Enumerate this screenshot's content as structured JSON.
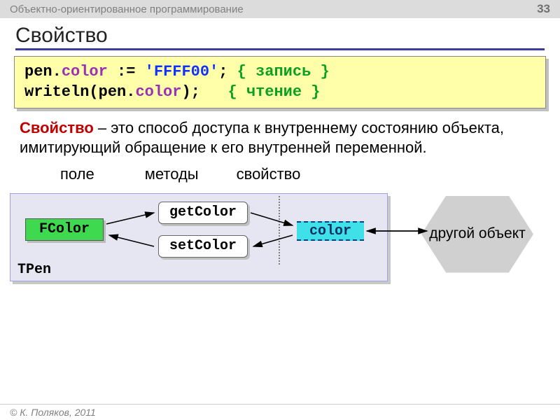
{
  "header": {
    "topic": "Объектно-ориентированное программирование",
    "page_number": "33"
  },
  "title": "Свойство",
  "code": {
    "line1_a": "pen.",
    "line1_prop": "color",
    "line1_b": " := ",
    "line1_val": "'FFFF00'",
    "line1_c": "; ",
    "line1_comment": "{ запись }",
    "line2_a": "writeln(pen.",
    "line2_prop": "color",
    "line2_b": ");   ",
    "line2_comment": "{ чтение }"
  },
  "definition": {
    "term": "Свойство",
    "rest": " – это способ доступа к внутреннему состоянию объекта, имитирующий обращение к его внутренней переменной."
  },
  "labels": {
    "field": "поле",
    "methods": "методы",
    "property": "свойство"
  },
  "diagram": {
    "class_name": "TPen",
    "field": "FColor",
    "getter": "getColor",
    "setter": "setColor",
    "property": "color",
    "other_object": "другой объект"
  },
  "footer": "© К. Поляков, 2011"
}
